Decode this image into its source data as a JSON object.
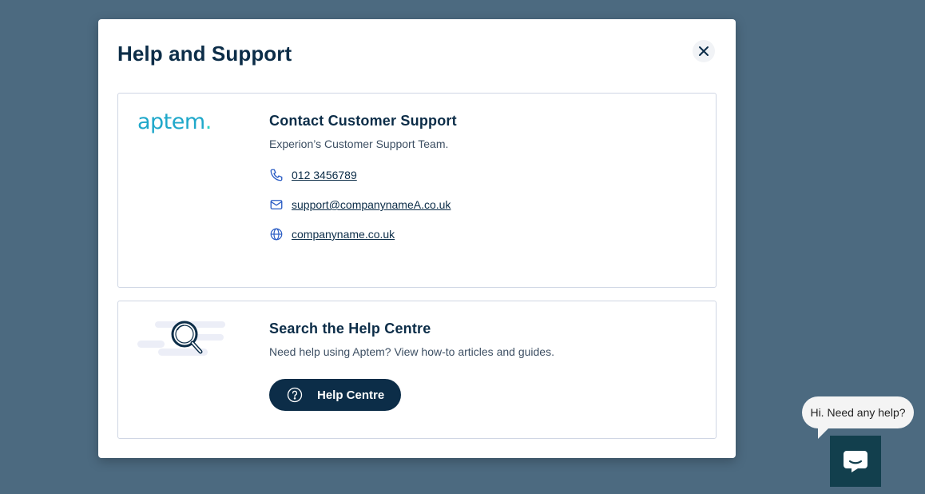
{
  "modal": {
    "title": "Help and Support",
    "close_icon": "close-icon"
  },
  "contact_card": {
    "logo_text": "aptem",
    "logo_dot": ".",
    "heading": "Contact Customer Support",
    "description": "Experion’s Customer Support Team.",
    "items": [
      {
        "icon": "phone-icon",
        "text": "012 3456789"
      },
      {
        "icon": "envelope-icon",
        "text": "support@companynameA.co.uk"
      },
      {
        "icon": "globe-icon",
        "text": "companyname.co.uk"
      }
    ]
  },
  "help_card": {
    "illustration": "magnifier-illustration",
    "heading": "Search the Help Centre",
    "description": "Need help using Aptem? View how-to articles and guides.",
    "button_label": "Help Centre",
    "button_icon": "question-circle-icon"
  },
  "chat_widget": {
    "greeting": "Hi. Need any help?",
    "launcher_icon": "chat-icon"
  },
  "colors": {
    "backdrop": "#4c6a80",
    "primary": "#0c2d48",
    "logo_accent": "#1fa8ca",
    "logo_dot": "#2ad3c6",
    "icon_blue": "#2a5cc4",
    "chat_launcher": "#123f4d"
  }
}
